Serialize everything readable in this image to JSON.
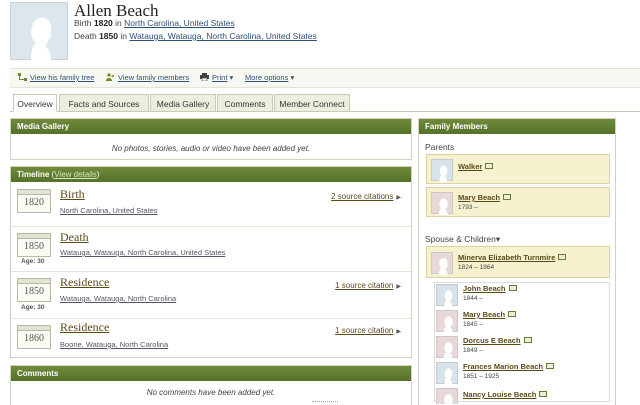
{
  "person": {
    "name": "Allen Beach",
    "birth": {
      "label": "Birth",
      "year": "1820",
      "in": "in",
      "place": "North Carolina, United States"
    },
    "death": {
      "label": "Death",
      "year": "1850",
      "in": "in",
      "place": "Watauga, Watauga, North Carolina, United States"
    }
  },
  "actions": {
    "family_tree": "View his family tree",
    "family_members": "View family members",
    "print": "Print",
    "more": "More options"
  },
  "tabs": [
    "Overview",
    "Facts and Sources",
    "Media Gallery",
    "Comments",
    "Member Connect"
  ],
  "media": {
    "title": "Media Gallery",
    "empty": "No photos, stories, audio or video have been added yet."
  },
  "timeline": {
    "title": "Timeline",
    "view_details": "View details",
    "events": [
      {
        "year": "1820",
        "age": "",
        "title": "Birth",
        "place": "North Carolina, United States",
        "citations": "2 source citations"
      },
      {
        "year": "1850",
        "age": "Age: 30",
        "title": "Death",
        "place": "Watauga, Watauga, North Carolina, United States",
        "citations": ""
      },
      {
        "year": "1850",
        "age": "Age: 30",
        "title": "Residence",
        "place": "Watauga, Watauga, North Carolina",
        "citations": "1 source citation"
      },
      {
        "year": "1860",
        "age": "",
        "title": "Residence",
        "place": "Boone, Watauga, North Carolina",
        "citations": "1 source citation"
      }
    ]
  },
  "comments": {
    "title": "Comments",
    "empty": "No comments have been added yet."
  },
  "family": {
    "title": "Family Members",
    "parents_label": "Parents",
    "parents": [
      {
        "name": "Walker",
        "dates": "",
        "sex": "m"
      },
      {
        "name": "Mary Beach",
        "dates": "1793 –",
        "sex": "f"
      }
    ],
    "spouse_label": "Spouse & Children",
    "spouse": {
      "name": "Minerva Elizabeth Turnmire",
      "dates": "1824 – 1864",
      "sex": "f"
    },
    "children": [
      {
        "name": "John Beach",
        "dates": "1844 –",
        "sex": "m"
      },
      {
        "name": "Mary Beach",
        "dates": "1845 –",
        "sex": "f"
      },
      {
        "name": "Dorcus E Beach",
        "dates": "1849 –",
        "sex": "f"
      },
      {
        "name": "Frances Marion Beach",
        "dates": "1851 – 1925",
        "sex": "m"
      },
      {
        "name": "Nancy Louise Beach",
        "dates": "",
        "sex": "f"
      }
    ]
  },
  "colors": {
    "header_green": "#5f7b30",
    "link": "#5a4a18",
    "highlight": "#f6f2d0"
  }
}
